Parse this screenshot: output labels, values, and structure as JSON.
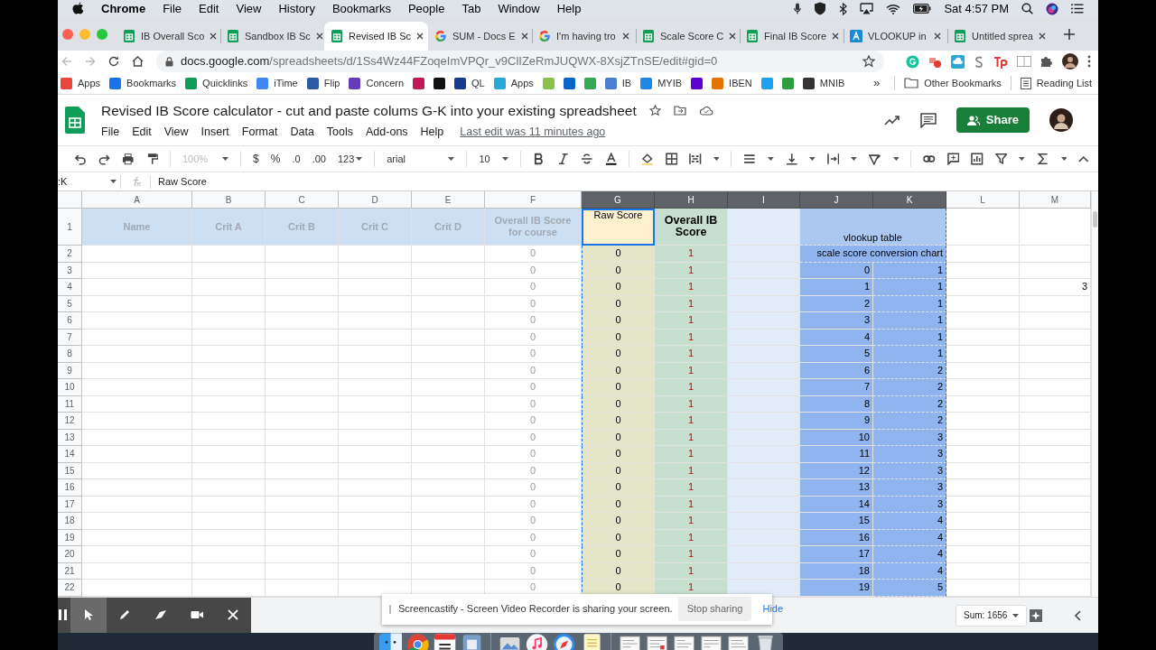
{
  "menu_bar": {
    "app": "Chrome",
    "items": [
      "File",
      "Edit",
      "View",
      "History",
      "Bookmarks",
      "People",
      "Tab",
      "Window",
      "Help"
    ],
    "clock": "Sat 4:57 PM"
  },
  "tabs": [
    {
      "title": "IB Overall Sco",
      "kind": "sheets",
      "selected": false
    },
    {
      "title": "Sandbox IB Sc",
      "kind": "sheets",
      "selected": false
    },
    {
      "title": "Revised IB Sc",
      "kind": "sheets",
      "selected": true
    },
    {
      "title": "SUM - Docs E",
      "kind": "google",
      "selected": false
    },
    {
      "title": "I'm having tro",
      "kind": "google",
      "selected": false
    },
    {
      "title": "Scale Score C",
      "kind": "sheets",
      "selected": false
    },
    {
      "title": "Final IB Score",
      "kind": "sheets",
      "selected": false
    },
    {
      "title": "VLOOKUP in",
      "kind": "docs",
      "selected": false
    },
    {
      "title": "Untitled sprea",
      "kind": "sheets",
      "selected": false
    }
  ],
  "address_bar": {
    "host": "docs.google.com",
    "path": "/spreadsheets/d/1Ss4Wz44FZoqeImVPQr_v9ClIZeRmJUQWX-8XsjZTnSE/edit#gid=0"
  },
  "bookmarks": [
    {
      "label": "Apps",
      "color": "#e8453c"
    },
    {
      "label": "Bookmarks",
      "color": "#1a73e8"
    },
    {
      "label": "Quicklinks",
      "color": "#0f9d58"
    },
    {
      "label": "iTime",
      "color": "#4285f4"
    },
    {
      "label": "Flip",
      "color": "#2c5aa0"
    },
    {
      "label": "Concern",
      "color": "#673ab7"
    },
    {
      "color": "#c2185b"
    },
    {
      "color": "#111111"
    },
    {
      "label": "QL",
      "color": "#1a3a8f"
    },
    {
      "label": "Apps",
      "color": "#2aa8d8"
    },
    {
      "color": "#8bc34a"
    },
    {
      "color": "#0a64c8"
    },
    {
      "color": "#34a853"
    },
    {
      "label": "IB",
      "color": "#4a7fd0"
    },
    {
      "label": "MYIB",
      "color": "#1e88e5"
    },
    {
      "color": "#5f01d1"
    },
    {
      "label": "IBEN",
      "color": "#e37400"
    },
    {
      "color": "#1da1f2"
    },
    {
      "color": "#2e9e3e"
    },
    {
      "label": "MNIB",
      "color": "#333333"
    }
  ],
  "bookmarks_overflow": "»",
  "other_bookmarks": "Other Bookmarks",
  "reading_list": "Reading List",
  "document": {
    "title": "Revised IB Score calculator - cut and paste colums G-K into your existing spreadsheet",
    "menus": [
      "File",
      "Edit",
      "View",
      "Insert",
      "Format",
      "Data",
      "Tools",
      "Add-ons",
      "Help"
    ],
    "last_edit": "Last edit was 11 minutes ago",
    "share": "Share"
  },
  "toolbar": {
    "zoom": "100%",
    "currency": "$",
    "percent": "%",
    "decrease_decimals": ".0",
    "increase_decimals": ".00",
    "number_format": "123",
    "font": "arial",
    "font_size": "10"
  },
  "formula_bar": {
    "name_box": ":K",
    "formula": "Raw Score"
  },
  "grid": {
    "columns": [
      {
        "letter": "A",
        "selected": false
      },
      {
        "letter": "B",
        "selected": false
      },
      {
        "letter": "C",
        "selected": false
      },
      {
        "letter": "D",
        "selected": false
      },
      {
        "letter": "E",
        "selected": false
      },
      {
        "letter": "F",
        "selected": false
      },
      {
        "letter": "G",
        "selected": true
      },
      {
        "letter": "H",
        "selected": true
      },
      {
        "letter": "I",
        "selected": true
      },
      {
        "letter": "J",
        "selected": true
      },
      {
        "letter": "K",
        "selected": true
      },
      {
        "letter": "L",
        "selected": false
      },
      {
        "letter": "M",
        "selected": false
      }
    ],
    "rows": [
      {
        "number": "1",
        "kind": "header",
        "merged_jk": true,
        "cells": [
          {
            "text": "Name",
            "selected": false
          },
          {
            "text": "Crit A",
            "selected": false
          },
          {
            "text": "Crit B",
            "selected": false
          },
          {
            "text": "Crit C",
            "selected": false
          },
          {
            "text": "Crit D",
            "selected": false
          },
          {
            "text": "Overall IB Score for course",
            "selected": false
          },
          {
            "text": "Raw Score",
            "selected": true
          },
          {
            "text": "Overall IB Score",
            "selected": false
          },
          {
            "text": null,
            "selected": false
          },
          {
            "text": "vlookup table",
            "selected": false
          },
          {
            "text": null,
            "selected": false
          },
          {
            "text": null,
            "selected": false
          }
        ]
      },
      {
        "number": "2",
        "kind": "data",
        "merged_jk": true,
        "cells": [
          null,
          null,
          null,
          null,
          null,
          "0",
          "0",
          "1",
          null,
          "scale score conversion chart",
          null,
          null
        ]
      },
      {
        "number": "3",
        "kind": "data",
        "merged_jk": false,
        "cells": [
          null,
          null,
          null,
          null,
          null,
          "0",
          "0",
          "1",
          null,
          "0",
          "1",
          null,
          null
        ]
      },
      {
        "number": "4",
        "kind": "data",
        "merged_jk": false,
        "cells": [
          null,
          null,
          null,
          null,
          null,
          "0",
          "0",
          "1",
          null,
          "1",
          "1",
          null,
          "3"
        ]
      },
      {
        "number": "5",
        "kind": "data",
        "merged_jk": false,
        "cells": [
          null,
          null,
          null,
          null,
          null,
          "0",
          "0",
          "1",
          null,
          "2",
          "1",
          null,
          null
        ]
      },
      {
        "number": "6",
        "kind": "data",
        "merged_jk": false,
        "cells": [
          null,
          null,
          null,
          null,
          null,
          "0",
          "0",
          "1",
          null,
          "3",
          "1",
          null,
          null
        ]
      },
      {
        "number": "7",
        "kind": "data",
        "merged_jk": false,
        "cells": [
          null,
          null,
          null,
          null,
          null,
          "0",
          "0",
          "1",
          null,
          "4",
          "1",
          null,
          null
        ]
      },
      {
        "number": "8",
        "kind": "data",
        "merged_jk": false,
        "cells": [
          null,
          null,
          null,
          null,
          null,
          "0",
          "0",
          "1",
          null,
          "5",
          "1",
          null,
          null
        ]
      },
      {
        "number": "9",
        "kind": "data",
        "merged_jk": false,
        "cells": [
          null,
          null,
          null,
          null,
          null,
          "0",
          "0",
          "1",
          null,
          "6",
          "2",
          null,
          null
        ]
      },
      {
        "number": "10",
        "kind": "data",
        "merged_jk": false,
        "cells": [
          null,
          null,
          null,
          null,
          null,
          "0",
          "0",
          "1",
          null,
          "7",
          "2",
          null,
          null
        ]
      },
      {
        "number": "11",
        "kind": "data",
        "merged_jk": false,
        "cells": [
          null,
          null,
          null,
          null,
          null,
          "0",
          "0",
          "1",
          null,
          "8",
          "2",
          null,
          null
        ]
      },
      {
        "number": "12",
        "kind": "data",
        "merged_jk": false,
        "cells": [
          null,
          null,
          null,
          null,
          null,
          "0",
          "0",
          "1",
          null,
          "9",
          "2",
          null,
          null
        ]
      },
      {
        "number": "13",
        "kind": "data",
        "merged_jk": false,
        "cells": [
          null,
          null,
          null,
          null,
          null,
          "0",
          "0",
          "1",
          null,
          "10",
          "3",
          null,
          null
        ]
      },
      {
        "number": "14",
        "kind": "data",
        "merged_jk": false,
        "cells": [
          null,
          null,
          null,
          null,
          null,
          "0",
          "0",
          "1",
          null,
          "11",
          "3",
          null,
          null
        ]
      },
      {
        "number": "15",
        "kind": "data",
        "merged_jk": false,
        "cells": [
          null,
          null,
          null,
          null,
          null,
          "0",
          "0",
          "1",
          null,
          "12",
          "3",
          null,
          null
        ]
      },
      {
        "number": "16",
        "kind": "data",
        "merged_jk": false,
        "cells": [
          null,
          null,
          null,
          null,
          null,
          "0",
          "0",
          "1",
          null,
          "13",
          "3",
          null,
          null
        ]
      },
      {
        "number": "17",
        "kind": "data",
        "merged_jk": false,
        "cells": [
          null,
          null,
          null,
          null,
          null,
          "0",
          "0",
          "1",
          null,
          "14",
          "3",
          null,
          null
        ]
      },
      {
        "number": "18",
        "kind": "data",
        "merged_jk": false,
        "cells": [
          null,
          null,
          null,
          null,
          null,
          "0",
          "0",
          "1",
          null,
          "15",
          "4",
          null,
          null
        ]
      },
      {
        "number": "19",
        "kind": "data",
        "merged_jk": false,
        "cells": [
          null,
          null,
          null,
          null,
          null,
          "0",
          "0",
          "1",
          null,
          "16",
          "4",
          null,
          null
        ]
      },
      {
        "number": "20",
        "kind": "data",
        "merged_jk": false,
        "cells": [
          null,
          null,
          null,
          null,
          null,
          "0",
          "0",
          "1",
          null,
          "17",
          "4",
          null,
          null
        ]
      },
      {
        "number": "21",
        "kind": "data",
        "merged_jk": false,
        "cells": [
          null,
          null,
          null,
          null,
          null,
          "0",
          "0",
          "1",
          null,
          "18",
          "4",
          null,
          null
        ]
      },
      {
        "number": "22",
        "kind": "data",
        "merged_jk": false,
        "cells": [
          null,
          null,
          null,
          null,
          null,
          "0",
          "0",
          "1",
          null,
          "19",
          "5",
          null,
          null
        ]
      }
    ]
  },
  "recorder_toolbar": {
    "tools": [
      {
        "kind": "pause",
        "selected": false
      },
      {
        "kind": "pointer",
        "selected": true
      },
      {
        "kind": "pen",
        "selected": false
      },
      {
        "kind": "eraser",
        "selected": false
      },
      {
        "kind": "camera",
        "selected": false
      },
      {
        "kind": "close",
        "selected": false
      }
    ]
  },
  "sharing_notice": {
    "message": "Screencastify - Screen Video Recorder is sharing your screen.",
    "stop": "Stop sharing",
    "hide": "Hide"
  },
  "sum": "Sum: 1656"
}
